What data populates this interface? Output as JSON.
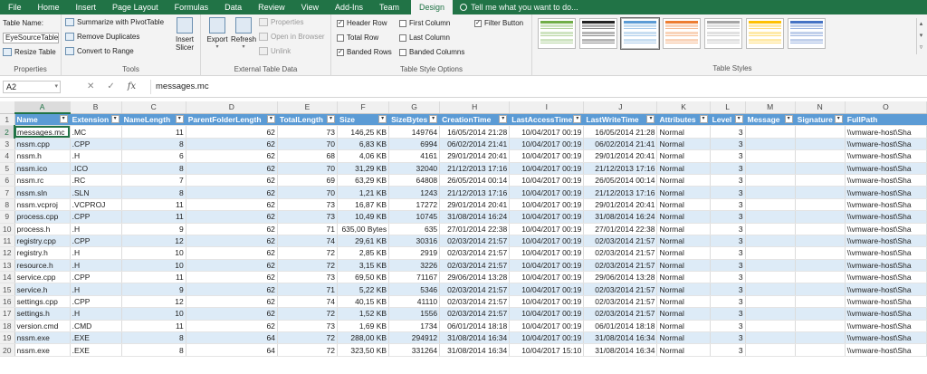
{
  "ribbon_tabs": [
    "File",
    "Home",
    "Insert",
    "Page Layout",
    "Formulas",
    "Data",
    "Review",
    "View",
    "Add-Ins",
    "Team",
    "Design"
  ],
  "active_tab": "Design",
  "tell_me": "Tell me what you want to do...",
  "properties": {
    "table_name_label": "Table Name:",
    "table_name_value": "EyeSourceTable",
    "resize_label": "Resize Table",
    "group_label": "Properties"
  },
  "tools": {
    "summarize": "Summarize with PivotTable",
    "remove_dup": "Remove Duplicates",
    "convert": "Convert to Range",
    "insert_slicer": "Insert Slicer",
    "group_label": "Tools"
  },
  "external": {
    "export": "Export",
    "refresh": "Refresh",
    "properties": "Properties",
    "open_browser": "Open in Browser",
    "unlink": "Unlink",
    "group_label": "External Table Data"
  },
  "style_options": {
    "header_row": "Header Row",
    "total_row": "Total Row",
    "banded_rows": "Banded Rows",
    "first_column": "First Column",
    "last_column": "Last Column",
    "banded_columns": "Banded Columns",
    "filter_button": "Filter Button",
    "group_label": "Table Style Options"
  },
  "table_styles": {
    "group_label": "Table Styles",
    "colors": [
      "#70ad47",
      "#222222",
      "#5b9bd5",
      "#ed7d31",
      "#a5a5a5",
      "#ffc000",
      "#4472c4"
    ]
  },
  "formula_bar": {
    "name_box": "A2",
    "cancel_icon": "✕",
    "enter_icon": "✓",
    "fx": "fx",
    "formula": "messages.mc"
  },
  "column_letters": [
    "A",
    "B",
    "C",
    "D",
    "E",
    "F",
    "G",
    "H",
    "I",
    "J",
    "K",
    "L",
    "M",
    "N",
    "O"
  ],
  "headers": [
    "Name",
    "Extension",
    "NameLength",
    "ParentFolderLength",
    "TotalLength",
    "Size",
    "SizeBytes",
    "CreationTime",
    "LastAccessTime",
    "LastWriteTime",
    "Attributes",
    "Level",
    "Message",
    "Signature",
    "FullPath"
  ],
  "rows": [
    [
      "messages.mc",
      ".MC",
      "11",
      "62",
      "73",
      "146,25 KB",
      "149764",
      "16/05/2014 21:28",
      "10/04/2017 00:19",
      "16/05/2014 21:28",
      "Normal",
      "3",
      "",
      "",
      "\\\\vmware-host\\Sha"
    ],
    [
      "nssm.cpp",
      ".CPP",
      "8",
      "62",
      "70",
      "6,83 KB",
      "6994",
      "06/02/2014 21:41",
      "10/04/2017 00:19",
      "06/02/2014 21:41",
      "Normal",
      "3",
      "",
      "",
      "\\\\vmware-host\\Sha"
    ],
    [
      "nssm.h",
      ".H",
      "6",
      "62",
      "68",
      "4,06 KB",
      "4161",
      "29/01/2014 20:41",
      "10/04/2017 00:19",
      "29/01/2014 20:41",
      "Normal",
      "3",
      "",
      "",
      "\\\\vmware-host\\Sha"
    ],
    [
      "nssm.ico",
      ".ICO",
      "8",
      "62",
      "70",
      "31,29 KB",
      "32040",
      "21/12/2013 17:16",
      "10/04/2017 00:19",
      "21/12/2013 17:16",
      "Normal",
      "3",
      "",
      "",
      "\\\\vmware-host\\Sha"
    ],
    [
      "nssm.rc",
      ".RC",
      "7",
      "62",
      "69",
      "63,29 KB",
      "64808",
      "26/05/2014 00:14",
      "10/04/2017 00:19",
      "26/05/2014 00:14",
      "Normal",
      "3",
      "",
      "",
      "\\\\vmware-host\\Sha"
    ],
    [
      "nssm.sln",
      ".SLN",
      "8",
      "62",
      "70",
      "1,21 KB",
      "1243",
      "21/12/2013 17:16",
      "10/04/2017 00:19",
      "21/12/2013 17:16",
      "Normal",
      "3",
      "",
      "",
      "\\\\vmware-host\\Sha"
    ],
    [
      "nssm.vcproj",
      ".VCPROJ",
      "11",
      "62",
      "73",
      "16,87 KB",
      "17272",
      "29/01/2014 20:41",
      "10/04/2017 00:19",
      "29/01/2014 20:41",
      "Normal",
      "3",
      "",
      "",
      "\\\\vmware-host\\Sha"
    ],
    [
      "process.cpp",
      ".CPP",
      "11",
      "62",
      "73",
      "10,49 KB",
      "10745",
      "31/08/2014 16:24",
      "10/04/2017 00:19",
      "31/08/2014 16:24",
      "Normal",
      "3",
      "",
      "",
      "\\\\vmware-host\\Sha"
    ],
    [
      "process.h",
      ".H",
      "9",
      "62",
      "71",
      "635,00 Bytes",
      "635",
      "27/01/2014 22:38",
      "10/04/2017 00:19",
      "27/01/2014 22:38",
      "Normal",
      "3",
      "",
      "",
      "\\\\vmware-host\\Sha"
    ],
    [
      "registry.cpp",
      ".CPP",
      "12",
      "62",
      "74",
      "29,61 KB",
      "30316",
      "02/03/2014 21:57",
      "10/04/2017 00:19",
      "02/03/2014 21:57",
      "Normal",
      "3",
      "",
      "",
      "\\\\vmware-host\\Sha"
    ],
    [
      "registry.h",
      ".H",
      "10",
      "62",
      "72",
      "2,85 KB",
      "2919",
      "02/03/2014 21:57",
      "10/04/2017 00:19",
      "02/03/2014 21:57",
      "Normal",
      "3",
      "",
      "",
      "\\\\vmware-host\\Sha"
    ],
    [
      "resource.h",
      ".H",
      "10",
      "62",
      "72",
      "3,15 KB",
      "3226",
      "02/03/2014 21:57",
      "10/04/2017 00:19",
      "02/03/2014 21:57",
      "Normal",
      "3",
      "",
      "",
      "\\\\vmware-host\\Sha"
    ],
    [
      "service.cpp",
      ".CPP",
      "11",
      "62",
      "73",
      "69,50 KB",
      "71167",
      "29/06/2014 13:28",
      "10/04/2017 00:19",
      "29/06/2014 13:28",
      "Normal",
      "3",
      "",
      "",
      "\\\\vmware-host\\Sha"
    ],
    [
      "service.h",
      ".H",
      "9",
      "62",
      "71",
      "5,22 KB",
      "5346",
      "02/03/2014 21:57",
      "10/04/2017 00:19",
      "02/03/2014 21:57",
      "Normal",
      "3",
      "",
      "",
      "\\\\vmware-host\\Sha"
    ],
    [
      "settings.cpp",
      ".CPP",
      "12",
      "62",
      "74",
      "40,15 KB",
      "41110",
      "02/03/2014 21:57",
      "10/04/2017 00:19",
      "02/03/2014 21:57",
      "Normal",
      "3",
      "",
      "",
      "\\\\vmware-host\\Sha"
    ],
    [
      "settings.h",
      ".H",
      "10",
      "62",
      "72",
      "1,52 KB",
      "1556",
      "02/03/2014 21:57",
      "10/04/2017 00:19",
      "02/03/2014 21:57",
      "Normal",
      "3",
      "",
      "",
      "\\\\vmware-host\\Sha"
    ],
    [
      "version.cmd",
      ".CMD",
      "11",
      "62",
      "73",
      "1,69 KB",
      "1734",
      "06/01/2014 18:18",
      "10/04/2017 00:19",
      "06/01/2014 18:18",
      "Normal",
      "3",
      "",
      "",
      "\\\\vmware-host\\Sha"
    ],
    [
      "nssm.exe",
      ".EXE",
      "8",
      "64",
      "72",
      "288,00 KB",
      "294912",
      "31/08/2014 16:34",
      "10/04/2017 00:19",
      "31/08/2014 16:34",
      "Normal",
      "3",
      "",
      "",
      "\\\\vmware-host\\Sha"
    ],
    [
      "nssm.exe",
      ".EXE",
      "8",
      "64",
      "72",
      "323,50 KB",
      "331264",
      "31/08/2014 16:34",
      "10/04/2017 15:10",
      "31/08/2014 16:34",
      "Normal",
      "3",
      "",
      "",
      "\\\\vmware-host\\Sha"
    ]
  ]
}
